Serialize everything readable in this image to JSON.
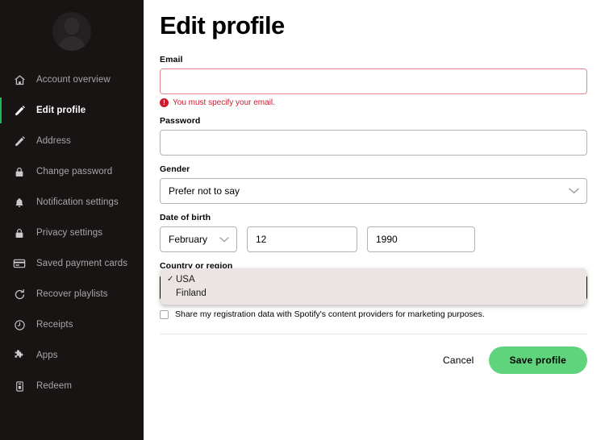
{
  "sidebar": {
    "avatar_name": "user-avatar-placeholder",
    "items": [
      {
        "label": "Account overview",
        "icon": "home-icon",
        "active": false
      },
      {
        "label": "Edit profile",
        "icon": "pencil-icon",
        "active": true
      },
      {
        "label": "Address",
        "icon": "pencil-icon",
        "active": false
      },
      {
        "label": "Change password",
        "icon": "lock-icon",
        "active": false
      },
      {
        "label": "Notification settings",
        "icon": "bell-icon",
        "active": false
      },
      {
        "label": "Privacy settings",
        "icon": "lock-icon",
        "active": false
      },
      {
        "label": "Saved payment cards",
        "icon": "credit-card-icon",
        "active": false
      },
      {
        "label": "Recover playlists",
        "icon": "refresh-icon",
        "active": false
      },
      {
        "label": "Receipts",
        "icon": "clock-icon",
        "active": false
      },
      {
        "label": "Apps",
        "icon": "puzzle-icon",
        "active": false
      },
      {
        "label": "Redeem",
        "icon": "gift-icon",
        "active": false
      }
    ]
  },
  "main": {
    "title": "Edit profile",
    "email": {
      "label": "Email",
      "value": "",
      "placeholder": "",
      "error": "You must specify your email.",
      "error_icon": "error-circle-icon"
    },
    "password": {
      "label": "Password",
      "value": "",
      "placeholder": ""
    },
    "gender": {
      "label": "Gender",
      "value": "Prefer not to say",
      "chevron_icon": "chevron-down-icon"
    },
    "date_of_birth": {
      "label": "Date of birth",
      "month": "February",
      "day": "12",
      "year": "1990",
      "chevron_icon": "chevron-down-icon"
    },
    "country": {
      "label": "Country or region",
      "selected": "USA",
      "options": [
        {
          "label": "USA",
          "selected": true,
          "check": "✓"
        },
        {
          "label": "Finland",
          "selected": false,
          "check": ""
        }
      ]
    },
    "share_checkbox": {
      "label": "Share my registration data with Spotify's content providers for marketing purposes.",
      "checked": false
    },
    "cancel_label": "Cancel",
    "save_label": "Save profile"
  },
  "colors": {
    "sidebar_bg": "#191414",
    "accent_green": "#1db954",
    "save_green": "#5fd47c",
    "error_red": "#cd1a2b",
    "dropdown_bg": "#ebe4e2"
  }
}
